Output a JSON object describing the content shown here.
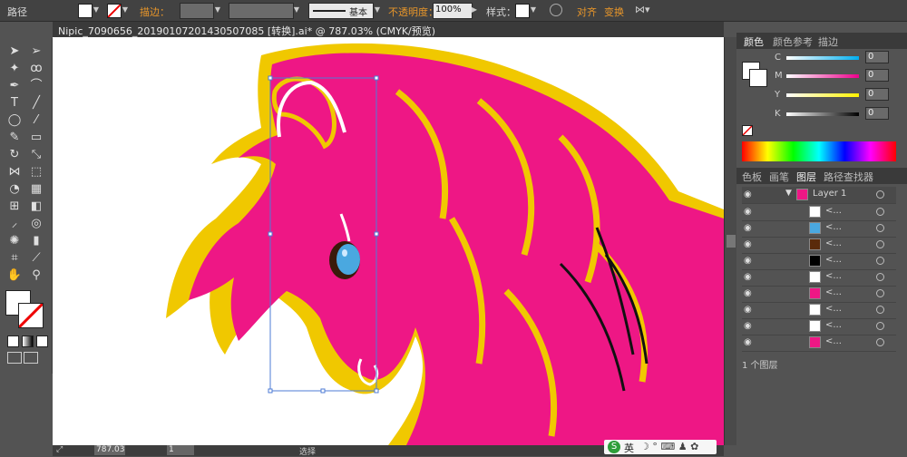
{
  "control_bar": {
    "mode_label": "路径",
    "stroke_label": "描边：",
    "stroke_style_label": "基本",
    "opacity_label": "不透明度：",
    "opacity_value": "100%",
    "style_label": "样式：",
    "align_label": "对齐",
    "transform_label": "变换"
  },
  "document": {
    "tab_title": "Nipic_7090656_20190107201430507085 [转换].ai* @ 787.03% (CMYK/预览)"
  },
  "color_panel": {
    "tabs": [
      "颜色",
      "颜色参考",
      "描边"
    ],
    "channels": [
      {
        "label": "C",
        "value": "0",
        "color": "#00aeef"
      },
      {
        "label": "M",
        "value": "0",
        "color": "#ec008c"
      },
      {
        "label": "Y",
        "value": "0",
        "color": "#fff200"
      },
      {
        "label": "K",
        "value": "0",
        "color": "#000000"
      }
    ]
  },
  "layers_panel": {
    "tabs": [
      "色板",
      "画笔",
      "图层",
      "路径查找器"
    ],
    "layer_name": "Layer 1",
    "sublayers": [
      "<...",
      "<...",
      "<...",
      "<...",
      "<...",
      "<...",
      "<...",
      "<...",
      "<..."
    ],
    "footer": "1 个图层"
  },
  "status_bar": {
    "zoom": "787.03",
    "page": "1",
    "tool_label": "选择"
  },
  "taskbar": {
    "ime_label": "英"
  },
  "colors": {
    "art_pink": "#ee1785",
    "art_yellow": "#f0c800",
    "accent_orange": "#e8962a"
  }
}
